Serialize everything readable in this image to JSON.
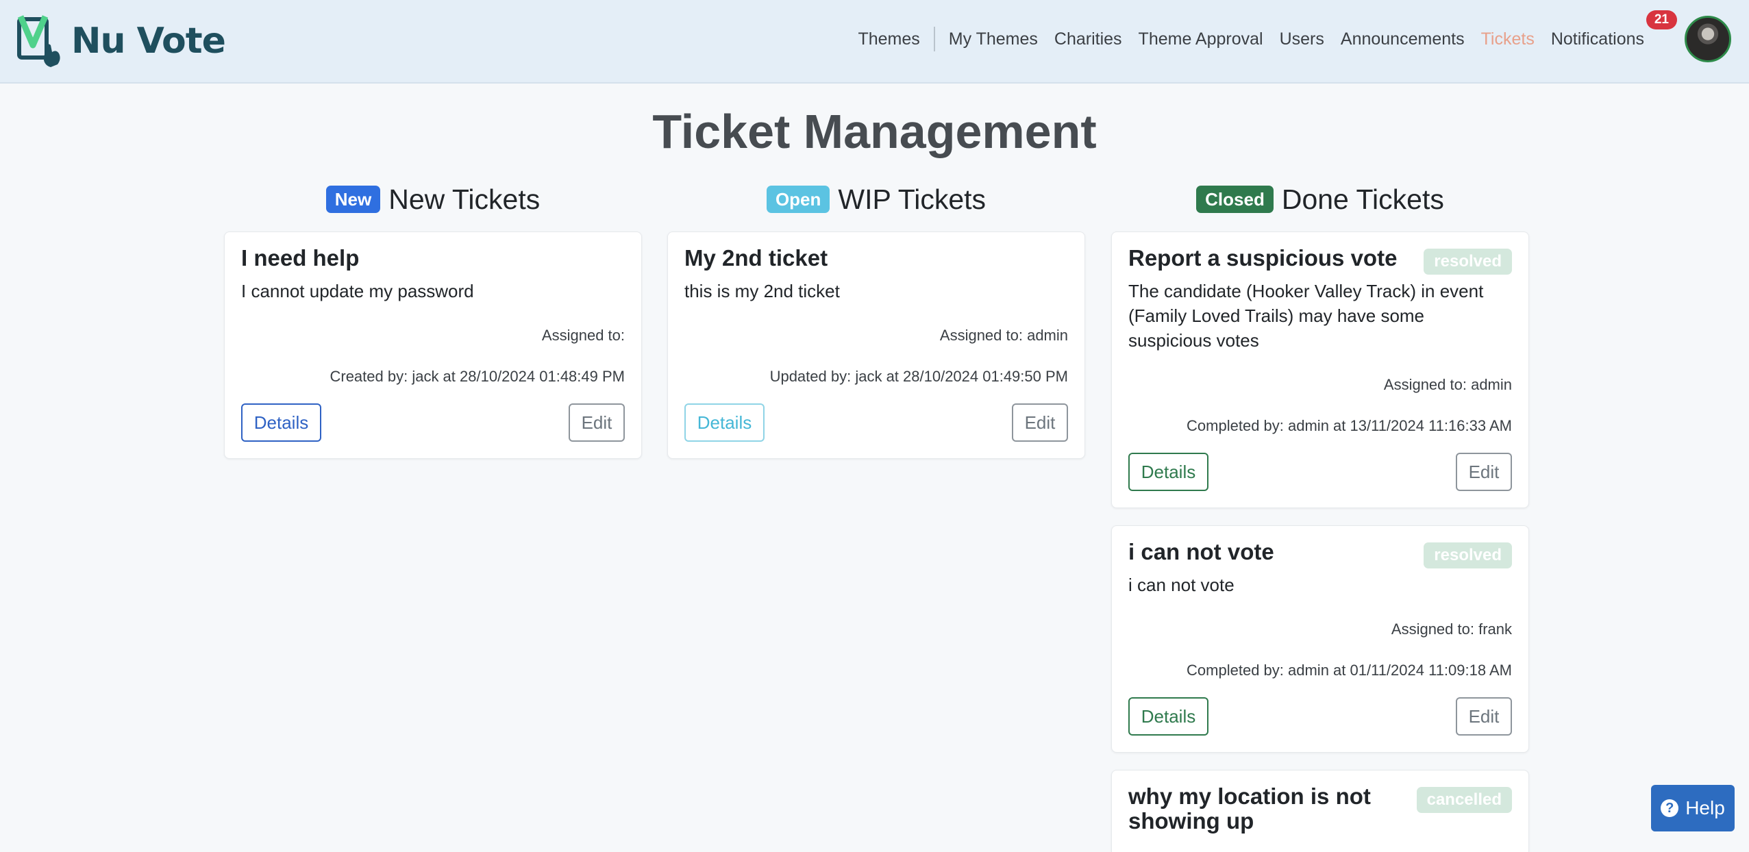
{
  "app": {
    "logo_text": "Nu Vote",
    "logo_icon": "checkmark-hand-icon"
  },
  "nav": {
    "items": [
      {
        "label": "Themes"
      },
      {
        "label": "My Themes"
      },
      {
        "label": "Charities"
      },
      {
        "label": "Theme Approval"
      },
      {
        "label": "Users"
      },
      {
        "label": "Announcements"
      },
      {
        "label": "Tickets",
        "active": true
      },
      {
        "label": "Notifications"
      }
    ],
    "notifications_count": "21",
    "avatar_icon": "user-avatar"
  },
  "page": {
    "title": "Ticket Management"
  },
  "columns": [
    {
      "badge": "New",
      "badge_color": "#2f6fe0",
      "heading": "New Tickets",
      "tickets": [
        {
          "title": "I need help",
          "description": "I cannot update my password",
          "assigned": "Assigned to:",
          "activity": "Created by: jack at 28/10/2024 01:48:49 PM",
          "details_label": "Details",
          "edit_label": "Edit"
        }
      ]
    },
    {
      "badge": "Open",
      "badge_color": "#5bc3e2",
      "heading": "WIP Tickets",
      "tickets": [
        {
          "title": "My 2nd ticket",
          "description": "this is my 2nd ticket",
          "assigned": "Assigned to: admin",
          "activity": "Updated by: jack at 28/10/2024 01:49:50 PM",
          "details_label": "Details",
          "edit_label": "Edit"
        }
      ]
    },
    {
      "badge": "Closed",
      "badge_color": "#2f7a4d",
      "heading": "Done Tickets",
      "tickets": [
        {
          "title": "Report a suspicious vote",
          "status": "resolved",
          "description": "The candidate (Hooker Valley Track) in event (Family Loved Trails) may have some suspicious votes",
          "assigned": "Assigned to: admin",
          "activity": "Completed by: admin at 13/11/2024 11:16:33 AM",
          "details_label": "Details",
          "edit_label": "Edit"
        },
        {
          "title": "i can not vote",
          "status": "resolved",
          "description": "i can not vote",
          "assigned": "Assigned to: frank",
          "activity": "Completed by: admin at 01/11/2024 11:09:18 AM",
          "details_label": "Details",
          "edit_label": "Edit"
        },
        {
          "title": "why my location is not showing up",
          "status": "cancelled"
        }
      ]
    }
  ],
  "help": {
    "label": "Help",
    "icon": "question-circle-icon"
  }
}
